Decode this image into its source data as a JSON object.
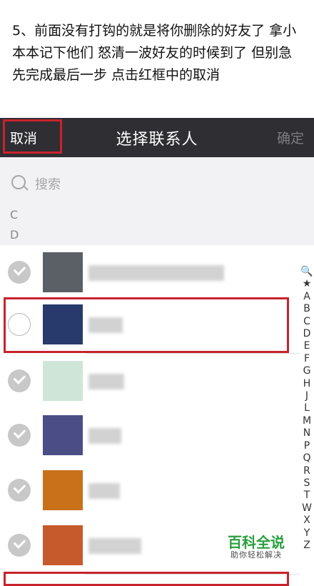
{
  "instruction": "5、前面没有打钩的就是将你删除的好友了 拿小本本记下他们 怒清一波好友的时候到了 但别急 先完成最后一步 点击红框中的取消",
  "navbar": {
    "cancel": "取消",
    "title": "选择联系人",
    "confirm": "确定"
  },
  "search": {
    "placeholder": "搜索"
  },
  "sections": [
    "C",
    "D"
  ],
  "contacts": [
    {
      "checked": true,
      "avatar_color": "#5b5f66"
    },
    {
      "checked": false,
      "avatar_color": "#283a6b"
    },
    {
      "checked": true,
      "avatar_color": "#cfe5d8"
    },
    {
      "checked": true,
      "avatar_color": "#4b4d86"
    },
    {
      "checked": true,
      "avatar_color": "#c8701a"
    },
    {
      "checked": true,
      "avatar_color": "#c75a2c"
    }
  ],
  "index_letters": [
    "🔍",
    "★",
    "A",
    "B",
    "C",
    "D",
    "E",
    "F",
    "G",
    "H",
    "J",
    "L",
    "M",
    "N",
    "P",
    "Q",
    "R",
    "S",
    "T",
    "W",
    "X",
    "Y",
    "Z"
  ],
  "watermark": {
    "title": "百科全说",
    "subtitle": "助你轻松解决"
  },
  "colors": {
    "navbar": "#2e2e33",
    "highlight_box": "#c8232c",
    "search_bg": "#f2f2f4",
    "watermark": "#2a9e3e"
  }
}
